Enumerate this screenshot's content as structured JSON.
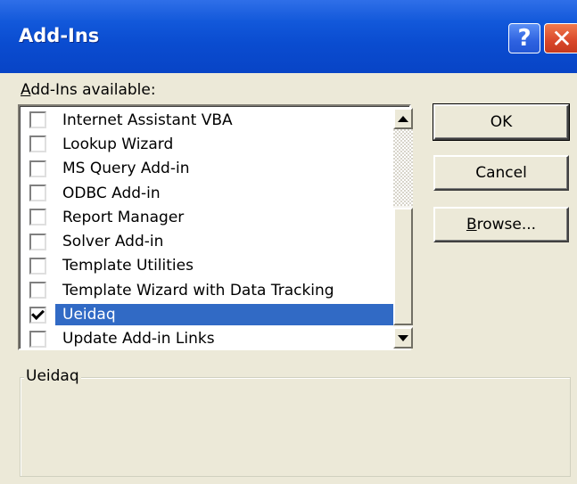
{
  "window": {
    "title": "Add-Ins",
    "help_label": "?",
    "close_label": "✕",
    "colors": {
      "titlebar": "#0a4cd0",
      "face": "#ece9d8",
      "selection": "#316ac5"
    }
  },
  "list": {
    "label_mnemonic": "A",
    "label_rest": "dd-Ins available:",
    "items": [
      {
        "label": "Internet Assistant VBA",
        "checked": false,
        "selected": false
      },
      {
        "label": "Lookup Wizard",
        "checked": false,
        "selected": false
      },
      {
        "label": "MS Query Add-in",
        "checked": false,
        "selected": false
      },
      {
        "label": "ODBC Add-in",
        "checked": false,
        "selected": false
      },
      {
        "label": "Report Manager",
        "checked": false,
        "selected": false
      },
      {
        "label": "Solver Add-in",
        "checked": false,
        "selected": false
      },
      {
        "label": "Template Utilities",
        "checked": false,
        "selected": false
      },
      {
        "label": "Template Wizard with Data Tracking",
        "checked": false,
        "selected": false
      },
      {
        "label": "Ueidaq",
        "checked": true,
        "selected": true
      },
      {
        "label": "Update Add-in Links",
        "checked": false,
        "selected": false
      }
    ]
  },
  "buttons": {
    "ok": "OK",
    "cancel": "Cancel",
    "browse_mnemonic": "B",
    "browse_rest": "rowse..."
  },
  "description": {
    "title": "Ueidaq",
    "text": ""
  },
  "icons": {
    "help": "help-icon",
    "close": "close-icon",
    "scroll_up": "scroll-up-arrow-icon",
    "scroll_down": "scroll-down-arrow-icon"
  }
}
